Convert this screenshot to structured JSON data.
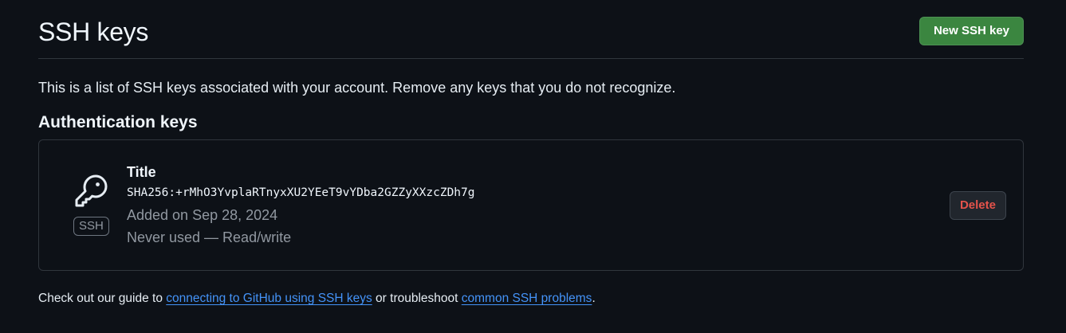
{
  "header": {
    "title": "SSH keys",
    "new_key_label": "New SSH key"
  },
  "description": "This is a list of SSH keys associated with your account. Remove any keys that you do not recognize.",
  "auth_section": {
    "title": "Authentication keys",
    "keys": [
      {
        "icon": "key-icon",
        "badge": "SSH",
        "title": "Title",
        "fingerprint": "SHA256:+rMhO3YvplaRTnyxXU2YEeT9vYDba2GZZyXXzcZDh7g",
        "added": "Added on Sep 28, 2024",
        "usage": "Never used — Read/write",
        "delete_label": "Delete"
      }
    ]
  },
  "footer": {
    "prefix": "Check out our guide to ",
    "link1": "connecting to GitHub using SSH keys",
    "middle": " or troubleshoot ",
    "link2": "common SSH problems",
    "suffix": "."
  },
  "colors": {
    "background": "#0d1117",
    "primary_button": "#3b8640",
    "danger_text": "#e5534b",
    "link": "#4493f8",
    "border": "#30363d"
  }
}
